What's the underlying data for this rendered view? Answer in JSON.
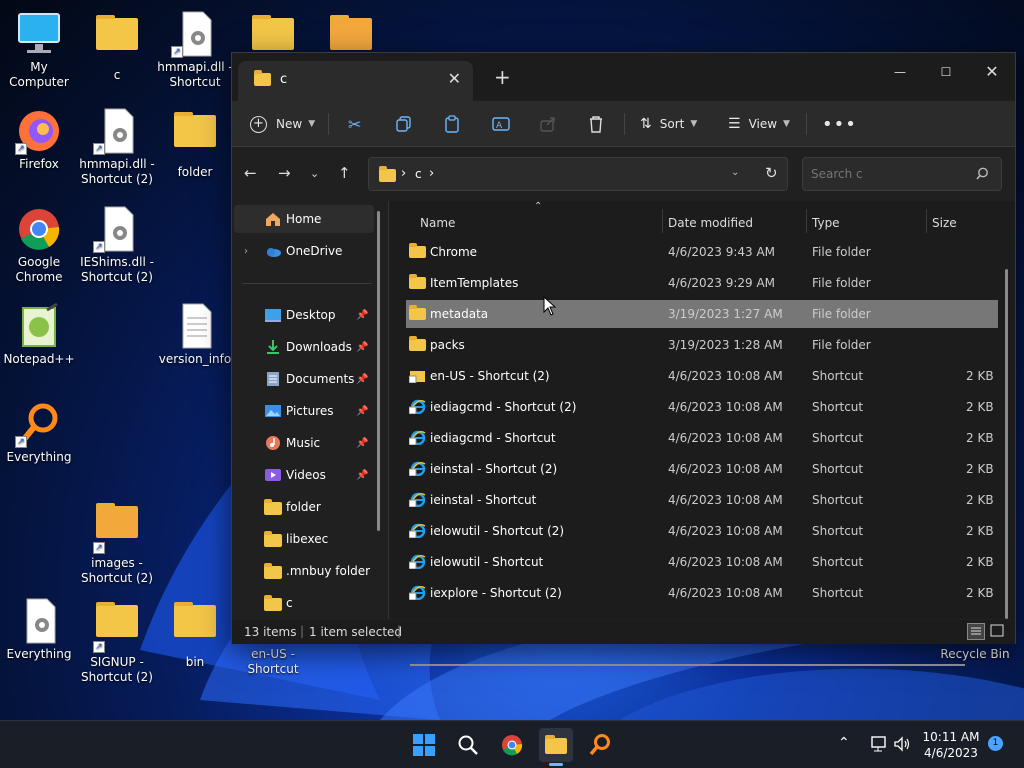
{
  "desktop": {
    "icons": [
      {
        "label": "My Computer"
      },
      {
        "label": "c"
      },
      {
        "label": "hmmapi.dll - Shortcut"
      },
      {
        "label": "Firefox"
      },
      {
        "label": "hmmapi.dll - Shortcut (2)"
      },
      {
        "label": "folder"
      },
      {
        "label": "Google Chrome"
      },
      {
        "label": "IEShims.dll - Shortcut (2)"
      },
      {
        "label": "Notepad++"
      },
      {
        "label": "version_info"
      },
      {
        "label": "Everything"
      },
      {
        "label": "images - Shortcut (2)"
      },
      {
        "label": "Everything"
      },
      {
        "label": "SIGNUP - Shortcut (2)"
      },
      {
        "label": "bin"
      },
      {
        "label": "en-US - Shortcut"
      },
      {
        "label": "Recycle Bin"
      }
    ]
  },
  "explorer": {
    "tab_title": "c",
    "toolbar": {
      "new_label": "New",
      "sort_label": "Sort",
      "view_label": "View"
    },
    "address": {
      "path": [
        "c"
      ],
      "search_placeholder": "Search c"
    },
    "nav": [
      {
        "label": "Home",
        "icon": "home-icon"
      },
      {
        "label": "OneDrive",
        "icon": "onedrive-icon"
      },
      {
        "label": "Desktop",
        "icon": "desktop-icon"
      },
      {
        "label": "Downloads",
        "icon": "downloads-icon"
      },
      {
        "label": "Documents",
        "icon": "documents-icon"
      },
      {
        "label": "Pictures",
        "icon": "pictures-icon"
      },
      {
        "label": "Music",
        "icon": "music-icon"
      },
      {
        "label": "Videos",
        "icon": "videos-icon"
      },
      {
        "label": "folder",
        "icon": "folder-icon"
      },
      {
        "label": "libexec",
        "icon": "folder-icon"
      },
      {
        "label": ".mnbuy folder",
        "icon": "folder-icon"
      },
      {
        "label": "c",
        "icon": "folder-icon"
      }
    ],
    "columns": {
      "name": "Name",
      "date": "Date modified",
      "type": "Type",
      "size": "Size"
    },
    "files": [
      {
        "name": "Chrome",
        "date": "4/6/2023 9:43 AM",
        "type": "File folder",
        "size": ""
      },
      {
        "name": "ItemTemplates",
        "date": "4/6/2023 9:29 AM",
        "type": "File folder",
        "size": ""
      },
      {
        "name": "metadata",
        "date": "3/19/2023 1:27 AM",
        "type": "File folder",
        "size": ""
      },
      {
        "name": "packs",
        "date": "3/19/2023 1:28 AM",
        "type": "File folder",
        "size": ""
      },
      {
        "name": "en-US - Shortcut (2)",
        "date": "4/6/2023 10:08 AM",
        "type": "Shortcut",
        "size": "2 KB"
      },
      {
        "name": "iediagcmd - Shortcut (2)",
        "date": "4/6/2023 10:08 AM",
        "type": "Shortcut",
        "size": "2 KB"
      },
      {
        "name": "iediagcmd - Shortcut",
        "date": "4/6/2023 10:08 AM",
        "type": "Shortcut",
        "size": "2 KB"
      },
      {
        "name": "ieinstal - Shortcut (2)",
        "date": "4/6/2023 10:08 AM",
        "type": "Shortcut",
        "size": "2 KB"
      },
      {
        "name": "ieinstal - Shortcut",
        "date": "4/6/2023 10:08 AM",
        "type": "Shortcut",
        "size": "2 KB"
      },
      {
        "name": "ielowutil - Shortcut (2)",
        "date": "4/6/2023 10:08 AM",
        "type": "Shortcut",
        "size": "2 KB"
      },
      {
        "name": "ielowutil - Shortcut",
        "date": "4/6/2023 10:08 AM",
        "type": "Shortcut",
        "size": "2 KB"
      },
      {
        "name": "iexplore - Shortcut (2)",
        "date": "4/6/2023 10:08 AM",
        "type": "Shortcut",
        "size": "2 KB"
      }
    ],
    "status": {
      "items": "13 items",
      "selected": "1 item selected"
    }
  },
  "taskbar": {
    "time": "10:11 AM",
    "date": "4/6/2023",
    "notification_count": "1"
  },
  "colors": {
    "accent": "#0078d4",
    "folder": "#f3c648",
    "selection": "#777777"
  }
}
